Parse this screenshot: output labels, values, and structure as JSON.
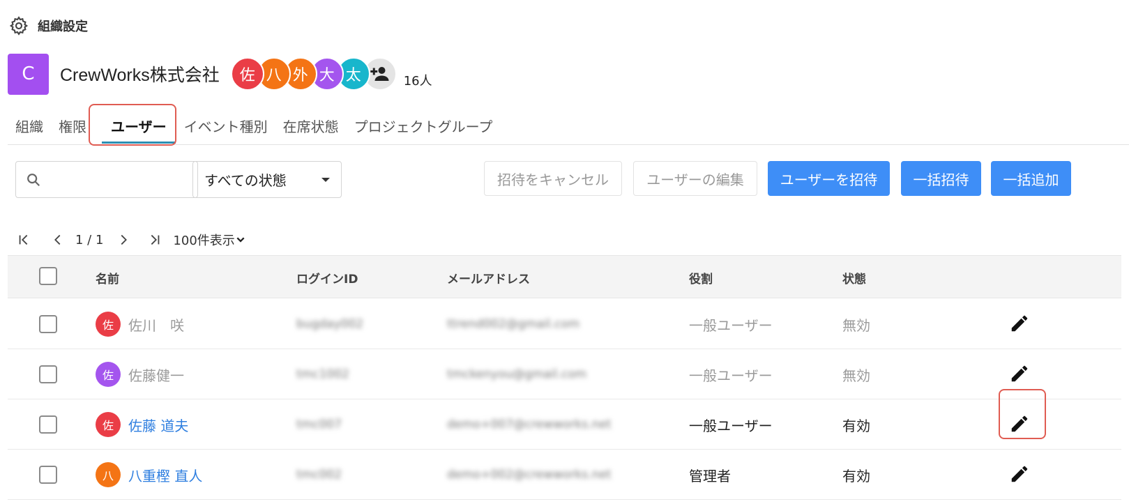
{
  "header": {
    "title": "組織設定",
    "icon": "gear-icon"
  },
  "organization": {
    "initial": "C",
    "name": "CrewWorks株式会社",
    "tile_color": "#a34ff0",
    "members": [
      {
        "char": "佐",
        "color": "#ea3d46"
      },
      {
        "char": "八",
        "color": "#f47415"
      },
      {
        "char": "外",
        "color": "#f47415"
      },
      {
        "char": "大",
        "color": "#a455ee"
      },
      {
        "char": "太",
        "color": "#18b6cc"
      }
    ],
    "add_member_icon": "add-person-icon",
    "member_count": "16人"
  },
  "tabs": [
    {
      "label": "組織"
    },
    {
      "label": "権限"
    },
    {
      "label": "ユーザー",
      "active": true
    },
    {
      "label": "イベント種別"
    },
    {
      "label": "在席状態"
    },
    {
      "label": "プロジェクトグループ"
    }
  ],
  "toolbar": {
    "search_placeholder": "",
    "status_filter": "すべての状態",
    "cancel_invite": "招待をキャンセル",
    "edit_users": "ユーザーの編集",
    "invite_user": "ユーザーを招待",
    "bulk_invite": "一括招待",
    "bulk_add": "一括追加"
  },
  "pagination": {
    "page": "1 / 1",
    "per_page": "100件表示"
  },
  "table": {
    "columns": [
      "名前",
      "ログインID",
      "メールアドレス",
      "役割",
      "状態"
    ],
    "rows": [
      {
        "avatar": "佐",
        "avatar_color": "#ea3d46",
        "name": "佐川　咲",
        "login_id": "bugday002",
        "email": "ttrend002@gmail.com",
        "role": "一般ユーザー",
        "status": "無効",
        "disabled": true
      },
      {
        "avatar": "佐",
        "avatar_color": "#a455ee",
        "name": "佐藤健一",
        "login_id": "tmc1002",
        "email": "tmckenyou@gmail.com",
        "role": "一般ユーザー",
        "status": "無効",
        "disabled": true
      },
      {
        "avatar": "佐",
        "avatar_color": "#ea3d46",
        "name": "佐藤 道夫",
        "login_id": "tmc007",
        "email": "demo+007@crewworks.net",
        "role": "一般ユーザー",
        "status": "有効",
        "disabled": false
      },
      {
        "avatar": "八",
        "avatar_color": "#f47415",
        "name": "八重樫 直人",
        "login_id": "tmc002",
        "email": "demo+002@crewworks.net",
        "role": "管理者",
        "status": "有効",
        "disabled": false
      }
    ]
  },
  "accent_colors": {
    "primary_button": "#3e8ef7",
    "tab_indicator": "#2d8fb3",
    "annotation": "#e05c52",
    "link": "#2f7fe0"
  }
}
